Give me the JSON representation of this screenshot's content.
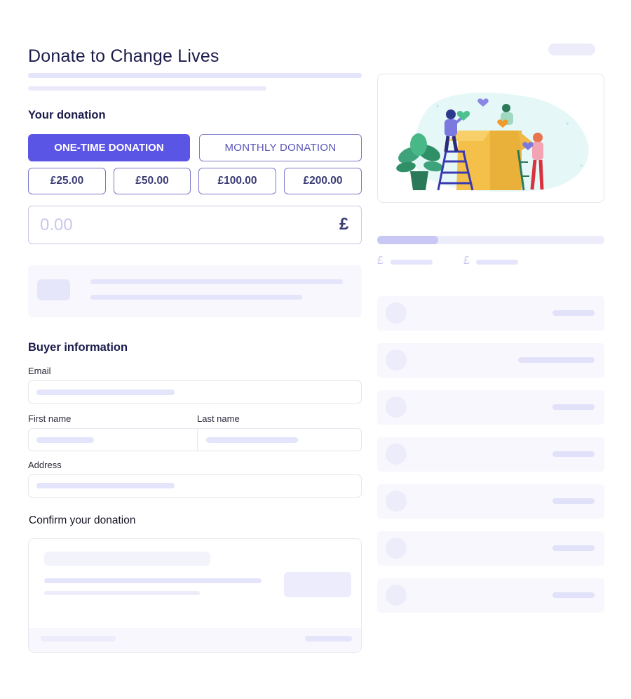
{
  "page": {
    "title": "Donate to Change Lives"
  },
  "donation": {
    "heading": "Your donation",
    "type_tabs": [
      {
        "label": "ONE-TIME DONATION",
        "selected": true
      },
      {
        "label": "MONTHLY DONATION",
        "selected": false
      }
    ],
    "amounts": [
      "£25.00",
      "£50.00",
      "£100.00",
      "£200.00"
    ],
    "custom_amount_placeholder": "0.00",
    "currency_symbol": "£"
  },
  "buyer": {
    "heading": "Buyer information",
    "email_label": "Email",
    "first_name_label": "First name",
    "last_name_label": "Last name",
    "address_label": "Address"
  },
  "confirm": {
    "heading": "Confirm your donation"
  },
  "stats": {
    "currency_left": "£",
    "currency_right": "£",
    "progress_fraction": 0.27
  },
  "colors": {
    "accent": "#5b55e6",
    "outline": "#7b78c8",
    "skeleton": "#e4e4fa",
    "panel": "#f7f7fd"
  }
}
